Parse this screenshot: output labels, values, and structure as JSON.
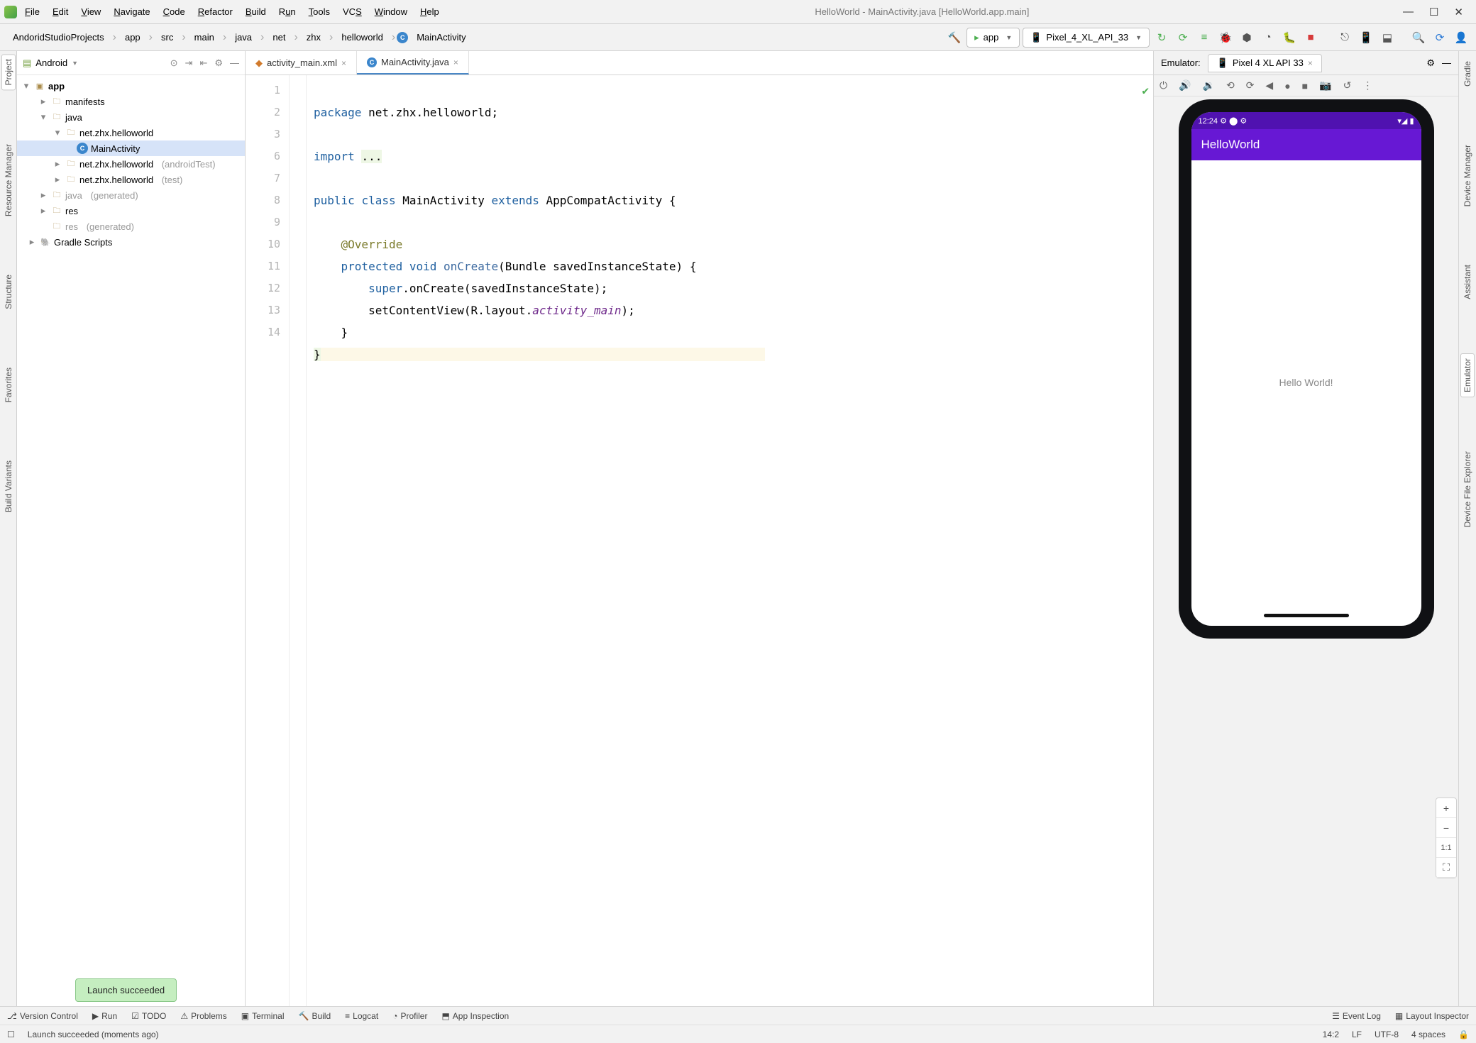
{
  "window": {
    "title": "HelloWorld - MainActivity.java [HelloWorld.app.main]",
    "menus": [
      "File",
      "Edit",
      "View",
      "Navigate",
      "Code",
      "Refactor",
      "Build",
      "Run",
      "Tools",
      "VCS",
      "Window",
      "Help"
    ]
  },
  "breadcrumb": [
    "AndoridStudioProjects",
    "app",
    "src",
    "main",
    "java",
    "net",
    "zhx",
    "helloworld",
    "MainActivity"
  ],
  "toolbar": {
    "run_config": "app",
    "device": "Pixel_4_XL_API_33"
  },
  "project": {
    "view_label": "Android",
    "root": "app",
    "nodes": {
      "manifests": "manifests",
      "java": "java",
      "pkg1": "net.zhx.helloworld",
      "main_activity": "MainActivity",
      "pkg2": "net.zhx.helloworld",
      "pkg2suffix": "(androidTest)",
      "pkg3": "net.zhx.helloworld",
      "pkg3suffix": "(test)",
      "java_gen": "java",
      "java_gen_suffix": "(generated)",
      "res": "res",
      "res_gen": "res",
      "res_gen_suffix": "(generated)",
      "gradle": "Gradle Scripts"
    },
    "left_tabs": [
      "Project",
      "Resource Manager",
      "Structure",
      "Favorites",
      "Build Variants"
    ]
  },
  "editor": {
    "tabs": [
      {
        "label": "activity_main.xml",
        "kind": "xml"
      },
      {
        "label": "MainActivity.java",
        "kind": "java",
        "active": true
      }
    ],
    "lines": [
      "1",
      "2",
      "3",
      "6",
      "7",
      "8",
      "9",
      "10",
      "11",
      "12",
      "13",
      "14"
    ],
    "code": {
      "l1a": "package",
      "l1b": " net.zhx.helloworld;",
      "l3a": "import ",
      "l3b": "...",
      "l7a": "public ",
      "l7b": "class ",
      "l7c": "MainActivity ",
      "l7d": "extends ",
      "l7e": "AppCompatActivity {",
      "l9": "@Override",
      "l10a": "protected ",
      "l10b": "void ",
      "l10c": "onCreate",
      "l10d": "(Bundle savedInstanceState) {",
      "l11a": "super",
      "l11b": ".onCreate(savedInstanceState);",
      "l12a": "setContentView(R.layout.",
      "l12b": "activity_main",
      "l12c": ");",
      "l13": "}",
      "l14": "}"
    }
  },
  "emulator": {
    "header": "Emulator:",
    "tab_label": "Pixel 4 XL API 33",
    "phone": {
      "status_time": "12:24",
      "app_title": "HelloWorld",
      "body_text": "Hello World!"
    },
    "zoom_11": "1:1",
    "right_tabs": [
      "Gradle",
      "Device Manager",
      "Assistant",
      "Emulator",
      "Device File Explorer"
    ]
  },
  "bottom_tabs": [
    "Version Control",
    "Run",
    "TODO",
    "Problems",
    "Terminal",
    "Build",
    "Logcat",
    "Profiler",
    "App Inspection",
    "Event Log",
    "Layout Inspector"
  ],
  "status": {
    "msg": "Launch succeeded (moments ago)",
    "pos": "14:2",
    "lf": "LF",
    "enc": "UTF-8",
    "spaces": "4 spaces"
  },
  "toast": "Launch succeeded"
}
